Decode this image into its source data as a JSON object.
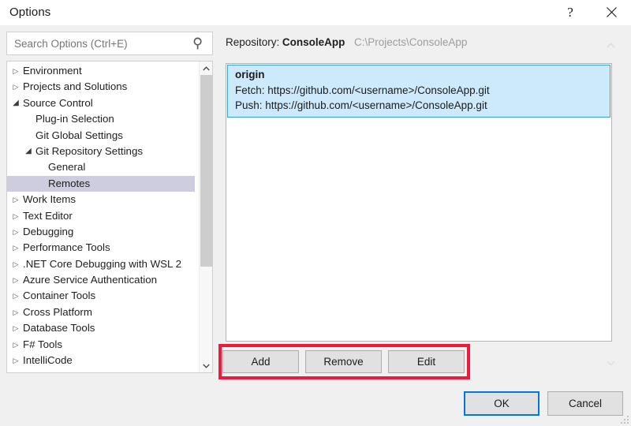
{
  "window": {
    "title": "Options",
    "help_icon": "question-mark-icon",
    "help_label": "?",
    "close_icon": "close-icon"
  },
  "search": {
    "placeholder": "Search Options (Ctrl+E)",
    "value": "",
    "icon": "search-icon"
  },
  "tree": {
    "items": [
      {
        "label": "Environment",
        "level": 0,
        "state": "collapsed",
        "selected": false
      },
      {
        "label": "Projects and Solutions",
        "level": 0,
        "state": "collapsed",
        "selected": false
      },
      {
        "label": "Source Control",
        "level": 0,
        "state": "expanded",
        "selected": false
      },
      {
        "label": "Plug-in Selection",
        "level": 1,
        "state": "leaf",
        "selected": false
      },
      {
        "label": "Git Global Settings",
        "level": 1,
        "state": "leaf",
        "selected": false
      },
      {
        "label": "Git Repository Settings",
        "level": 1,
        "state": "expanded",
        "selected": false
      },
      {
        "label": "General",
        "level": 2,
        "state": "leaf",
        "selected": false
      },
      {
        "label": "Remotes",
        "level": 2,
        "state": "leaf",
        "selected": true
      },
      {
        "label": "Work Items",
        "level": 0,
        "state": "collapsed",
        "selected": false
      },
      {
        "label": "Text Editor",
        "level": 0,
        "state": "collapsed",
        "selected": false
      },
      {
        "label": "Debugging",
        "level": 0,
        "state": "collapsed",
        "selected": false
      },
      {
        "label": "Performance Tools",
        "level": 0,
        "state": "collapsed",
        "selected": false
      },
      {
        "label": ".NET Core Debugging with WSL 2",
        "level": 0,
        "state": "collapsed",
        "selected": false
      },
      {
        "label": "Azure Service Authentication",
        "level": 0,
        "state": "collapsed",
        "selected": false
      },
      {
        "label": "Container Tools",
        "level": 0,
        "state": "collapsed",
        "selected": false
      },
      {
        "label": "Cross Platform",
        "level": 0,
        "state": "collapsed",
        "selected": false
      },
      {
        "label": "Database Tools",
        "level": 0,
        "state": "collapsed",
        "selected": false
      },
      {
        "label": "F# Tools",
        "level": 0,
        "state": "collapsed",
        "selected": false
      },
      {
        "label": "IntelliCode",
        "level": 0,
        "state": "collapsed",
        "selected": false
      }
    ],
    "scrollbar": {
      "up_icon": "chevron-up-icon",
      "down_icon": "chevron-down-icon"
    }
  },
  "repository": {
    "label": "Repository:",
    "name": "ConsoleApp",
    "path": "C:\\Projects\\ConsoleApp",
    "collapse_icon": "chevron-up-icon",
    "expand_icon": "chevron-down-icon"
  },
  "remotes": [
    {
      "name": "origin",
      "fetch": "Fetch: https://github.com/<username>/ConsoleApp.git",
      "push": "Push: https://github.com/<username>/ConsoleApp.git",
      "selected": true
    }
  ],
  "actions": {
    "add_label": "Add",
    "remove_label": "Remove",
    "edit_label": "Edit"
  },
  "footer": {
    "ok_label": "OK",
    "cancel_label": "Cancel"
  },
  "annotation": {
    "highlight_color": "#ec1b3b"
  },
  "colors": {
    "accent": "#0078d7",
    "selection_blue": "#cdeafc",
    "selection_gray": "#cdcddf",
    "dialog_bg": "#f0f0f0"
  }
}
